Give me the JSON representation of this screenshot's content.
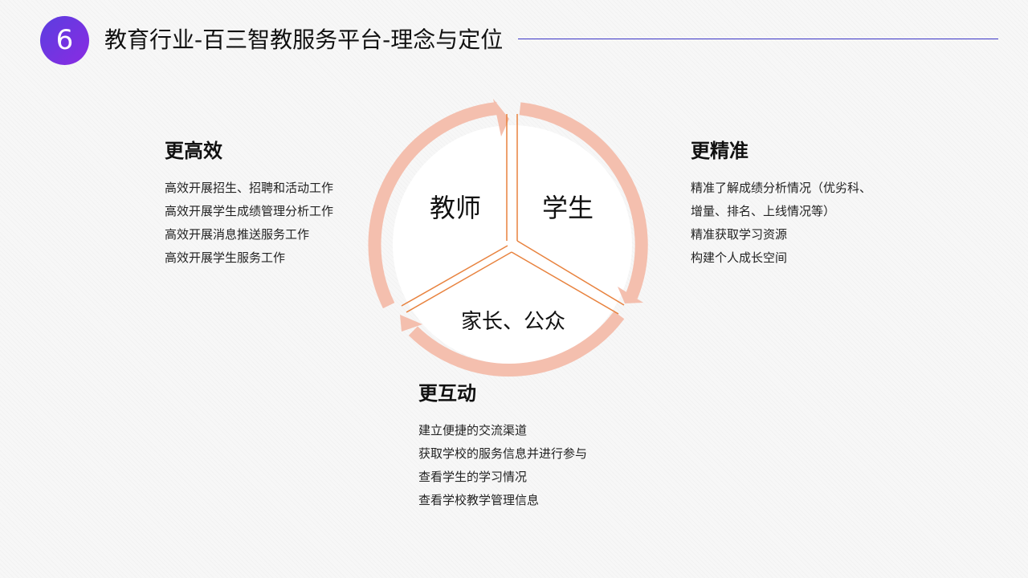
{
  "header": {
    "number": "6",
    "title": "教育行业-百三智教服务平台-理念与定位"
  },
  "cycle": {
    "segments": [
      {
        "label": "教师"
      },
      {
        "label": "学生"
      },
      {
        "label": "家长、公众"
      }
    ],
    "colors": {
      "ring": "#f4bfae",
      "divider": "#e8823e",
      "fill": "#ffffff"
    }
  },
  "blocks": {
    "left": {
      "heading": "更高效",
      "items": [
        "高效开展招生、招聘和活动工作",
        "高效开展学生成绩管理分析工作",
        "高效开展消息推送服务工作",
        "高效开展学生服务工作"
      ]
    },
    "right": {
      "heading": "更精准",
      "items": [
        "精准了解成绩分析情况（优劣科、",
        "增量、排名、上线情况等）",
        "精准获取学习资源",
        "构建个人成长空间"
      ]
    },
    "bottom": {
      "heading": "更互动",
      "items": [
        "建立便捷的交流渠道",
        "获取学校的服务信息并进行参与",
        "查看学生的学习情况",
        "查看学校教学管理信息"
      ]
    }
  },
  "theme": {
    "badge_gradient_start": "#5b3ee0",
    "badge_gradient_end": "#8a2be2",
    "rule_color": "#3b35c6"
  }
}
